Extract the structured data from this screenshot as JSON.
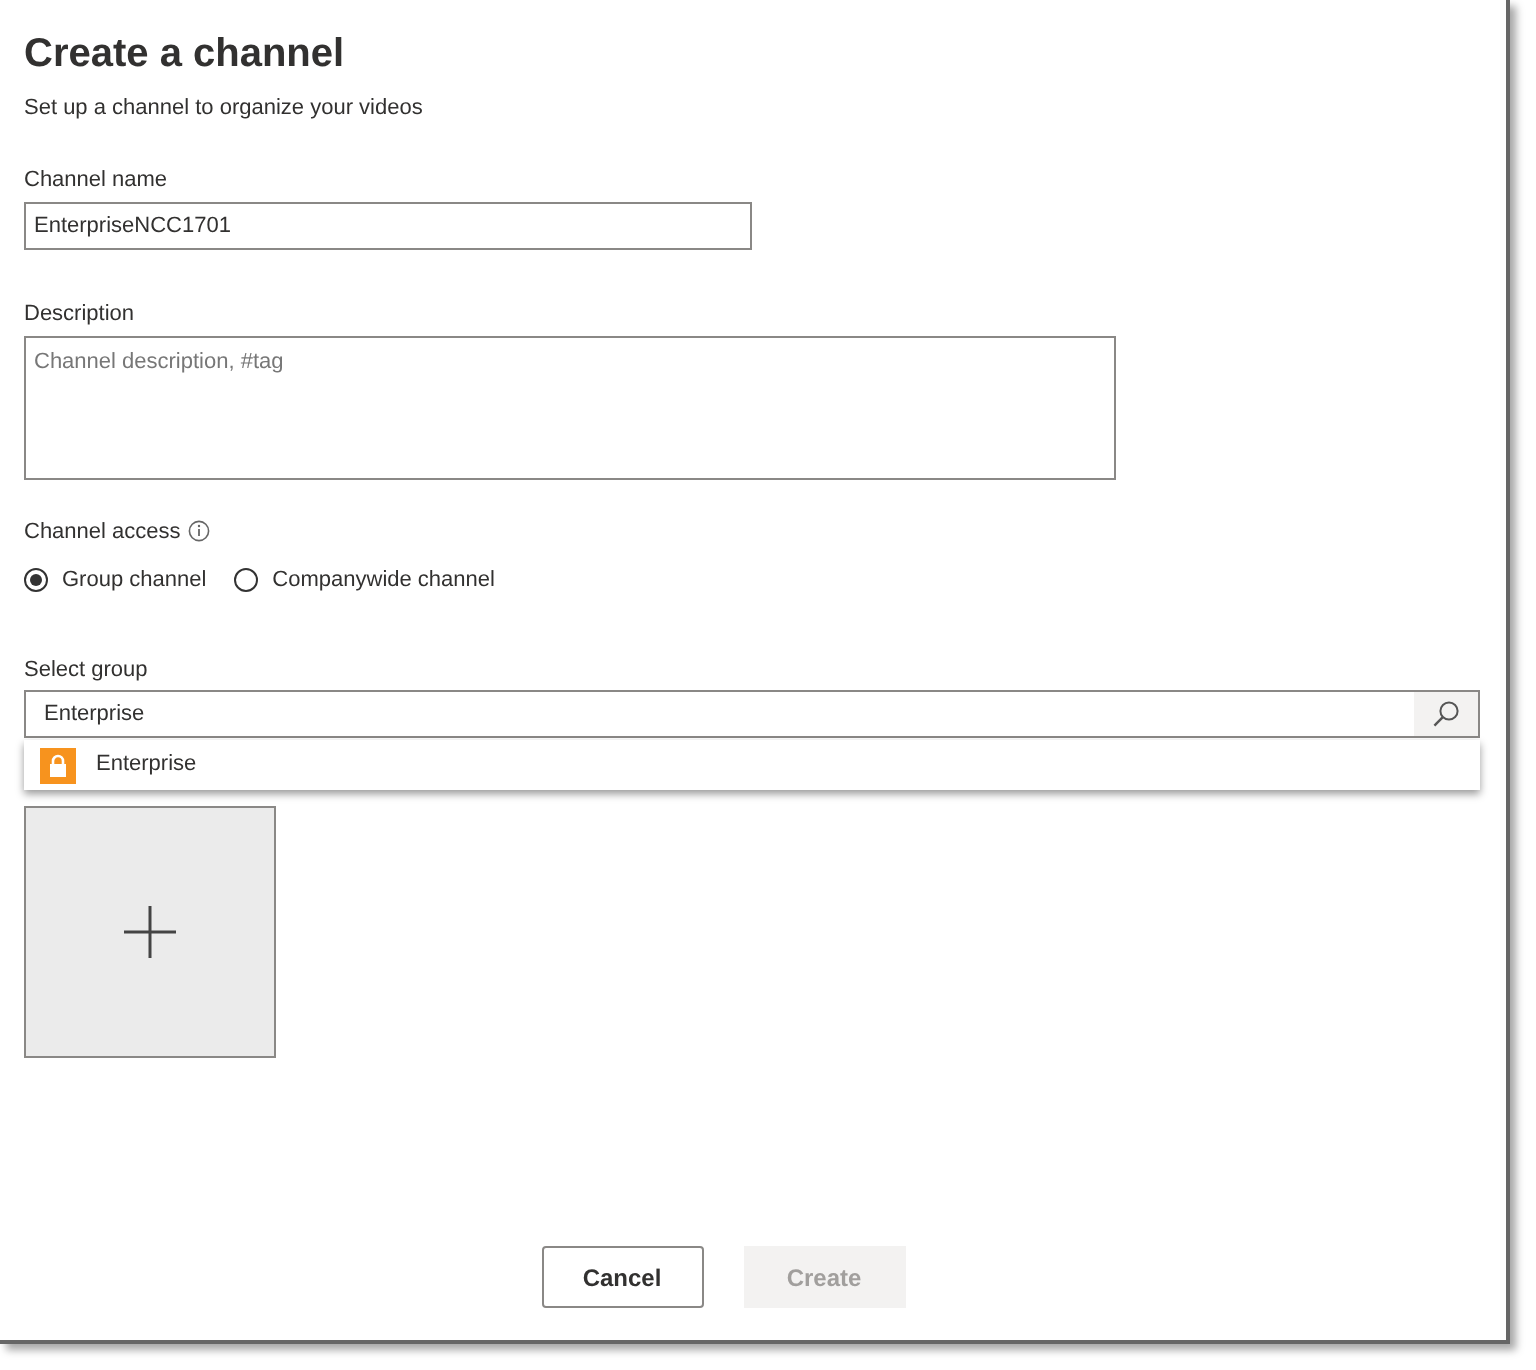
{
  "title": "Create a channel",
  "subtitle": "Set up a channel to organize your videos",
  "channel_name": {
    "label": "Channel name",
    "value": "EnterpriseNCC1701"
  },
  "description": {
    "label": "Description",
    "placeholder": "Channel description, #tag"
  },
  "channel_access": {
    "label": "Channel access",
    "options": [
      {
        "label": "Group channel",
        "selected": true
      },
      {
        "label": "Companywide channel",
        "selected": false
      }
    ]
  },
  "select_group": {
    "label": "Select group",
    "value": "Enterprise",
    "suggestions": [
      {
        "label": "Enterprise"
      }
    ]
  },
  "buttons": [
    {
      "label": "Cancel",
      "disabled": false
    },
    {
      "label": "Create",
      "disabled": true
    }
  ]
}
